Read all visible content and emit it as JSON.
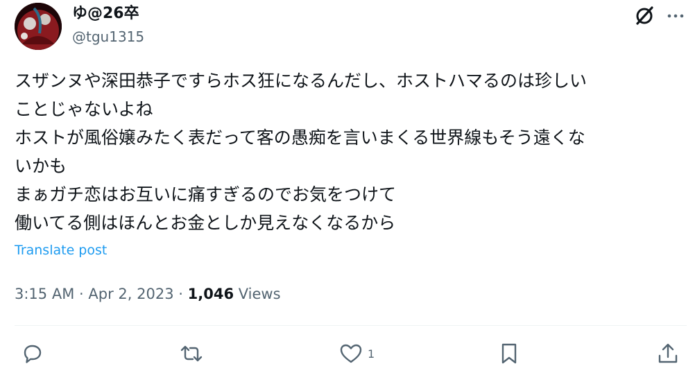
{
  "user": {
    "display_name": "ゆ@26卒",
    "handle": "@tgu1315"
  },
  "header_icons": {
    "grok": "grok-icon",
    "more": "more-icon"
  },
  "tweet": {
    "lines": [
      "スザンヌや深田恭子ですらホス狂になるんだし、ホストハマるのは珍しい",
      "ことじゃないよね",
      "ホストが風俗嬢みたく表だって客の愚痴を言いまくる世界線もそう遠くな",
      "いかも",
      "まぁガチ恋はお互いに痛すぎるのでお気をつけて",
      "働いてる側はほんとお金としか見えなくなるから"
    ],
    "translate_label": "Translate post"
  },
  "meta": {
    "time": "3:15 AM",
    "separator": "·",
    "date": "Apr 2, 2023",
    "views_count": "1,046",
    "views_label": "Views"
  },
  "actions": {
    "reply": {
      "icon": "reply-icon",
      "count": ""
    },
    "repost": {
      "icon": "repost-icon",
      "count": ""
    },
    "like": {
      "icon": "heart-icon",
      "count": "1"
    },
    "bookmark": {
      "icon": "bookmark-icon",
      "count": ""
    },
    "share": {
      "icon": "share-icon",
      "count": ""
    }
  },
  "colors": {
    "text": "#0f1419",
    "secondary": "#536471",
    "link": "#1d9bf0",
    "divider": "#eff3f4"
  }
}
